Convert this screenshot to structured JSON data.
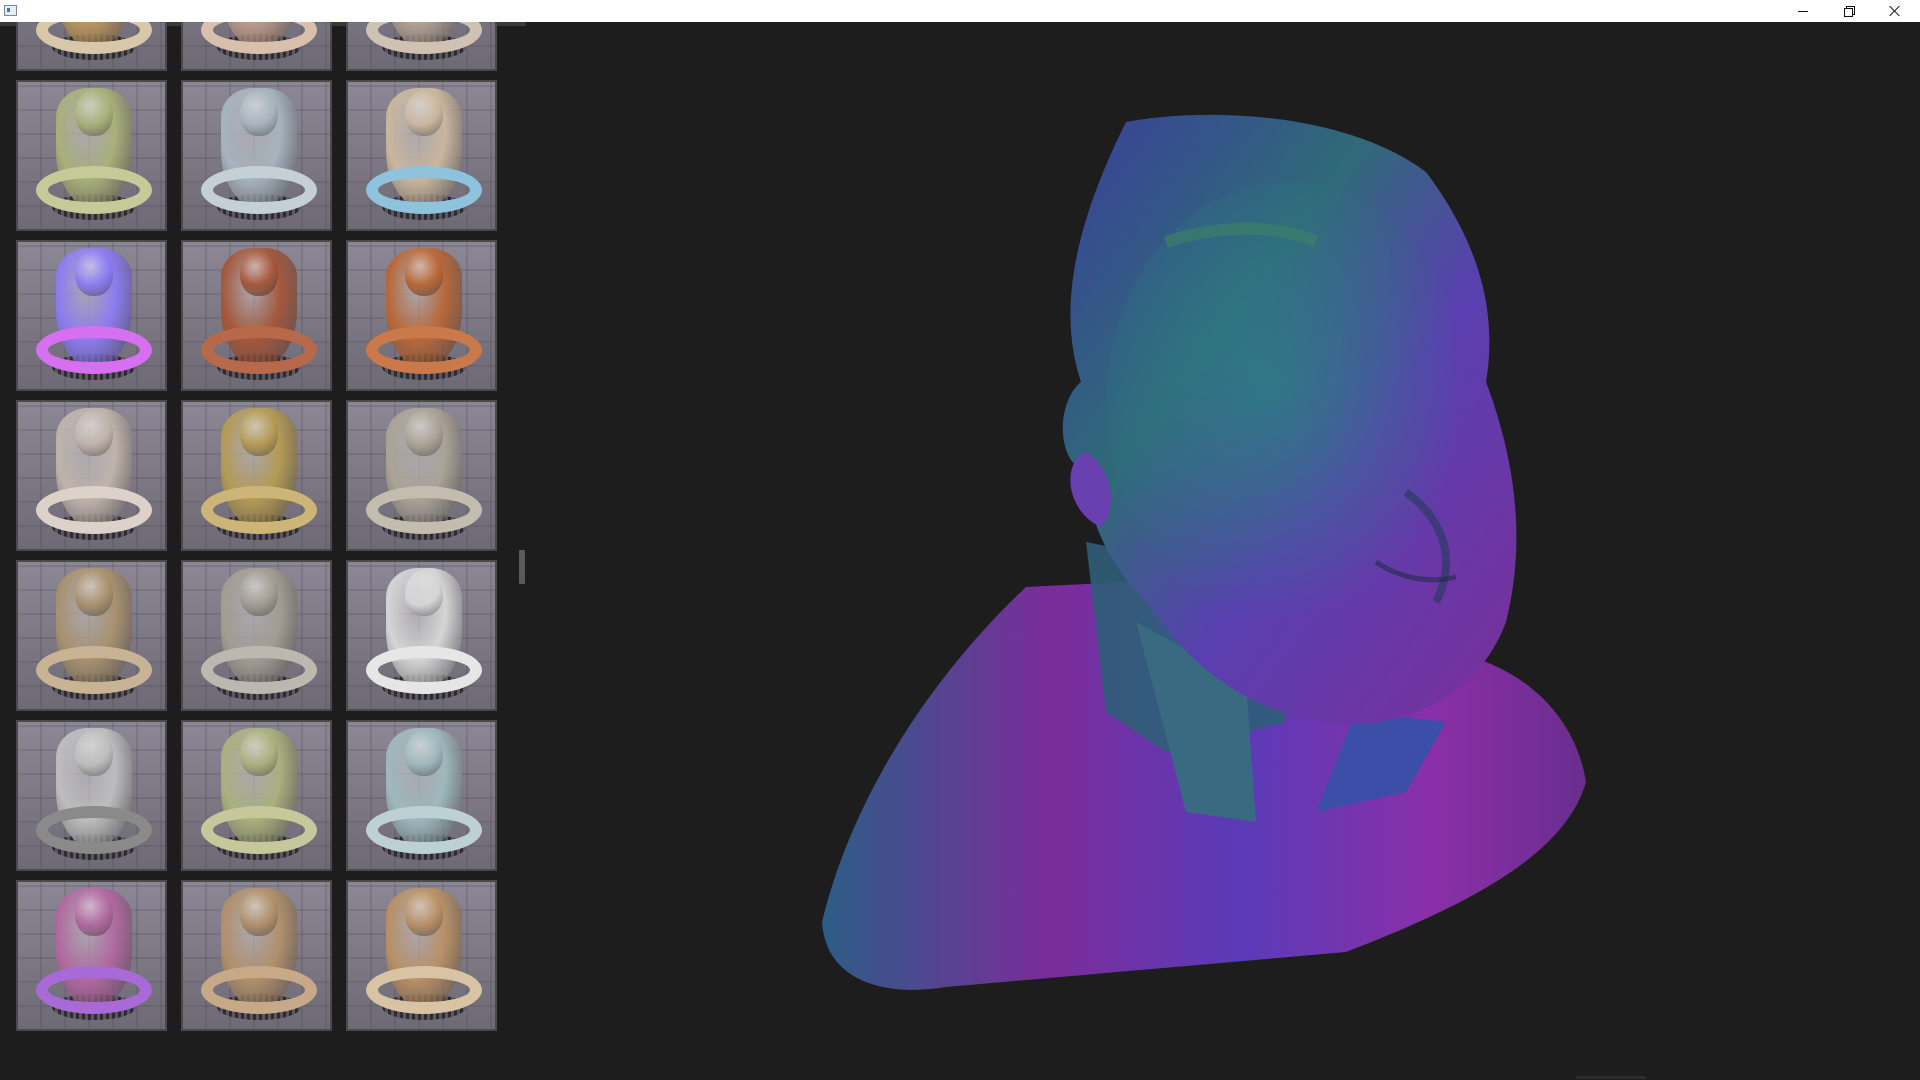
{
  "window": {
    "title": "",
    "controls": {
      "minimize": "minimize-icon",
      "maximize": "restore-icon",
      "close": "close-icon"
    }
  },
  "materials": [
    {
      "name": "",
      "color": "#c29a62",
      "ring": "#d8c7a8"
    },
    {
      "name": "",
      "color": "#c2a08f",
      "ring": "#d8c0ac"
    },
    {
      "name": "",
      "color": "#b8a79a",
      "ring": "#cfc2b2"
    },
    {
      "name": "",
      "color": "#a8b07a",
      "ring": "#c6c998"
    },
    {
      "name": "",
      "color": "#a7b3bd",
      "ring": "#c4d0d6"
    },
    {
      "name": "",
      "color": "#c9b69e",
      "ring": "#8fc2dc"
    },
    {
      "name": "",
      "color": "#8d7cf0",
      "ring": "#d66ff0"
    },
    {
      "name": "",
      "color": "#a4583c",
      "ring": "#b8694a"
    },
    {
      "name": "",
      "color": "#b7683a",
      "ring": "#c9794a"
    },
    {
      "name": "",
      "color": "#bfb3ab",
      "ring": "#ddd2ca"
    },
    {
      "name": "",
      "color": "#b49a55",
      "ring": "#cdb578"
    },
    {
      "name": "",
      "color": "#aaa396",
      "ring": "#c4bdaf"
    },
    {
      "name": "",
      "color": "#a8916f",
      "ring": "#c8b394"
    },
    {
      "name": "",
      "color": "#a29c93",
      "ring": "#bdb8af"
    },
    {
      "name": "",
      "color": "#d5d5d5",
      "ring": "#e6e6e6"
    },
    {
      "name": "",
      "color": "#bdbdbd",
      "ring": "#8a8a8a"
    },
    {
      "name": "",
      "color": "#aab07e",
      "ring": "#c6c79a"
    },
    {
      "name": "",
      "color": "#9fb8bc",
      "ring": "#bdd1d4"
    },
    {
      "name": "",
      "color": "#b06aa0",
      "ring": "#a76ad6"
    },
    {
      "name": "",
      "color": "#b0906c",
      "ring": "#c7a988"
    },
    {
      "name": "",
      "color": "#b89066",
      "ring": "#d8c3a4"
    }
  ],
  "viewport": {
    "background": "#1d1d1d",
    "model": "normal-shaded-head-bust"
  }
}
